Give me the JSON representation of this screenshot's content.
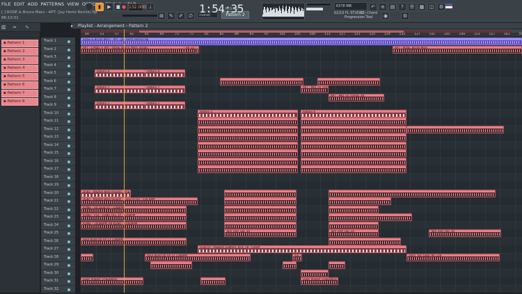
{
  "menu": {
    "items": [
      "FILE",
      "EDIT",
      "ADD",
      "PATTERNS",
      "VIEW",
      "OPTIONS",
      "TOOLS",
      "HELP"
    ],
    "project_title": "[ ] ROSÉ & Bruno Mars - APT. (Jay Hertz Remix).flp",
    "position": "86:10:01"
  },
  "transport": {
    "tempo": "132.000",
    "time": "1:54:35",
    "time_small": "M:S:CS",
    "pattern": "Pattern 2",
    "preset": "(none)",
    "cpu": "6378 MB",
    "cpu_sub": "32",
    "hint_line1": "02/10  FL STUDIO | Chord",
    "hint_line2": "Progression Tool"
  },
  "playlist": {
    "title": "Playlist - Arrangement › Pattern 2",
    "ruler_ticks": [
      "49",
      "53",
      "57",
      "61",
      "65",
      "69",
      "73",
      "77",
      "81",
      "85",
      "89",
      "93",
      "97",
      "101",
      "105",
      "109",
      "113",
      "117",
      "121",
      "125",
      "129",
      "133",
      "137",
      "141",
      "145",
      "149",
      "153",
      "157",
      "161",
      "165"
    ],
    "tracks": [
      "Track 1",
      "Track 2",
      "Track 3",
      "Track 4",
      "Track 5",
      "Track 6",
      "Track 7",
      "Track 8",
      "Track 9",
      "Track 10",
      "Track 11",
      "Track 12",
      "Track 13",
      "Track 14",
      "Track 15",
      "Track 16",
      "Track 17",
      "Track 18",
      "Track 19",
      "Track 20",
      "Track 21",
      "Track 22",
      "Track 23",
      "Track 24",
      "Track 25",
      "Track 26",
      "Track 27",
      "Track 28",
      "Track 29",
      "Track 30",
      "Track 31",
      "Track 32"
    ]
  },
  "patterns": [
    "Pattern 1",
    "Pattern 2",
    "Pattern 3",
    "Pattern 4",
    "Pattern 5",
    "Pattern 6",
    "Pattern 7",
    "Pattern 8"
  ],
  "clips": {
    "t1": "ROSÉ & Bruno Mars - APT. (Jay Hertz Remix).flp",
    "t2a": "APT - x Main + APT - ROSE_Bruno_Mars_vocals",
    "t2b": "AP_vo",
    "t2c": "APT - ROSE_Bruno Mars",
    "p8": "Pattern 8",
    "p7": "Pattern 7",
    "p1": "Pattern 1",
    "p5": "Pattern 5",
    "p6": "Pattern 6",
    "p4": "Pattern 4",
    "t11a": "APT - MID_vo_comps",
    "t12a": "APT - MID_vo_comps_48",
    "t22": "Dubu - Napton Bass Housse - Impact11",
    "t23": "Dubu - Napton Bass Houser - Long Fill 02 - 126 BPM",
    "t24": "KLING - Fill Long 02 - 126BPM",
    "t25": "KLING - FILL - LONG FILL 10 - 126BPM",
    "t26": "KLING - 1000BPM_A6 KLING - 1000BPM",
    "t29": "SEGI Build Up Fill 13 126BPM",
    "t28": "Tom_end_cop_20",
    "t29b": "Fluid LP - Howard_ESMSP1_Kick_18 - Cutoff",
    "t30": "SEGI Build Up Fill 12 126BPM",
    "t30b": "Kle_18",
    "t30c": "2002_Top_Loop_96_126",
    "t32a": "Lead_Impact_ChapDelay",
    "t32b": "Lead_Impact_ChapDelay"
  },
  "colors": {
    "clip_accent": "#e97d86",
    "clip_body": "#7d3b42",
    "vocal_clip": "#5b4bc7",
    "playhead": "#e8a53a",
    "background": "#262d32"
  },
  "icons": [
    "play-icon",
    "stop-icon",
    "record-icon",
    "metronome-icon",
    "mixer-icon",
    "piano-roll-icon",
    "browser-icon",
    "plugin-icon",
    "help-icon",
    "settings-icon",
    "flag-icon"
  ]
}
